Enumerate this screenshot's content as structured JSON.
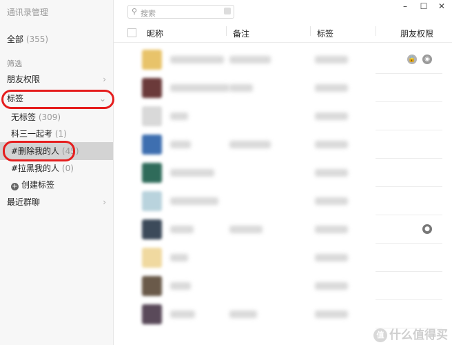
{
  "app": {
    "title": "通讯录管理"
  },
  "sidebar": {
    "all_label": "全部",
    "all_count": "(355)",
    "filter_section": "筛选",
    "friend_permission": "朋友权限",
    "tags_label": "标签",
    "tags": [
      {
        "label": "无标签",
        "count": "(309)"
      },
      {
        "label": "科三一起考",
        "count": "(1)"
      },
      {
        "label": "#删除我的人",
        "count": "(45)"
      },
      {
        "label": "#拉黑我的人",
        "count": "(0)"
      }
    ],
    "create_tag": "创建标签",
    "recent_groups": "最近群聊"
  },
  "search": {
    "placeholder": "搜索"
  },
  "window_controls": {
    "minimize": "–",
    "maximize": "☐",
    "close": "✕"
  },
  "table": {
    "columns": [
      "昵称",
      "备注",
      "标签",
      "朋友权限"
    ],
    "rows": [
      {
        "avatar_color": "#e8c36a",
        "icons": [
          "lock",
          "eye"
        ]
      },
      {
        "avatar_color": "#6b3a3a",
        "icons": []
      },
      {
        "avatar_color": "#d9d9d9",
        "icons": []
      },
      {
        "avatar_color": "#3e6fb0",
        "icons": []
      },
      {
        "avatar_color": "#2f6b5a",
        "icons": []
      },
      {
        "avatar_color": "#b9d3dd",
        "icons": []
      },
      {
        "avatar_color": "#3c4a5a",
        "icons": [
          "user"
        ]
      },
      {
        "avatar_color": "#f0d9a0",
        "icons": []
      },
      {
        "avatar_color": "#6a5a4a",
        "icons": []
      },
      {
        "avatar_color": "#5a4a5a",
        "icons": []
      }
    ]
  },
  "watermark": {
    "text": "什么值得买",
    "icon": "值"
  }
}
